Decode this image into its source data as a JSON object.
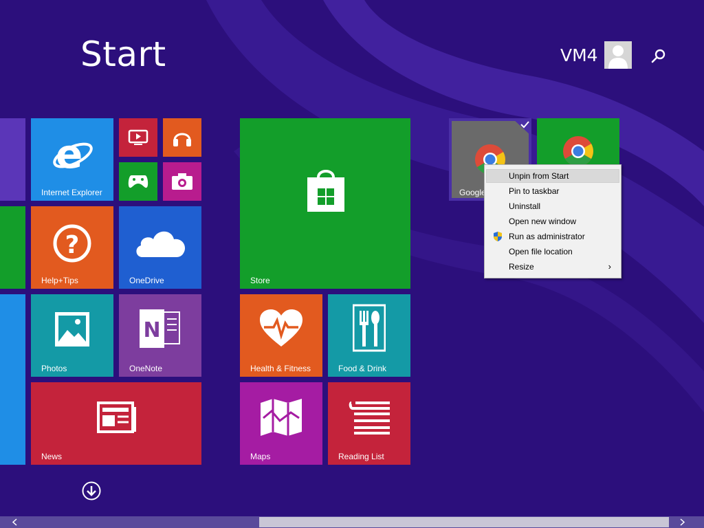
{
  "header": {
    "title": "Start",
    "user_name": "VM4"
  },
  "tiles": [
    {
      "id": "internet-explorer",
      "label": "Internet Explorer",
      "color": "#1f8ee6",
      "icon": "internet-explorer-icon"
    },
    {
      "id": "video",
      "label": "",
      "color": "#c4233b",
      "icon": "video-icon"
    },
    {
      "id": "music",
      "label": "",
      "color": "#e25a1f",
      "icon": "headphones-icon"
    },
    {
      "id": "games",
      "label": "",
      "color": "#139e2a",
      "icon": "xbox-controller-icon"
    },
    {
      "id": "camera",
      "label": "",
      "color": "#b81c8e",
      "icon": "camera-icon"
    },
    {
      "id": "help-tips",
      "label": "Help+Tips",
      "color": "#e25a1f",
      "icon": "question-icon"
    },
    {
      "id": "onedrive",
      "label": "OneDrive",
      "color": "#1f5fd1",
      "icon": "cloud-icon"
    },
    {
      "id": "photos",
      "label": "Photos",
      "color": "#149aa6",
      "icon": "photo-icon"
    },
    {
      "id": "onenote",
      "label": "OneNote",
      "color": "#7d3d9e",
      "icon": "onenote-icon"
    },
    {
      "id": "news",
      "label": "News",
      "color": "#c4233b",
      "icon": "news-icon"
    },
    {
      "id": "store",
      "label": "Store",
      "color": "#139e2a",
      "icon": "store-bag-icon"
    },
    {
      "id": "health-fitness",
      "label": "Health & Fitness",
      "color": "#e25a1f",
      "icon": "heart-pulse-icon"
    },
    {
      "id": "food-drink",
      "label": "Food & Drink",
      "color": "#149aa6",
      "icon": "fork-knife-icon"
    },
    {
      "id": "maps",
      "label": "Maps",
      "color": "#a51ca3",
      "icon": "map-icon"
    },
    {
      "id": "reading-list",
      "label": "Reading List",
      "color": "#c4233b",
      "icon": "reading-list-icon"
    },
    {
      "id": "google-chrome-selected",
      "label": "Google",
      "color": "#6a6a6a",
      "icon": "chrome-icon"
    },
    {
      "id": "google-chrome-2",
      "label": "",
      "color": "#139e2a",
      "icon": "chrome-icon"
    }
  ],
  "context_menu": {
    "items": [
      {
        "label": "Unpin from Start",
        "highlighted": true
      },
      {
        "label": "Pin to taskbar"
      },
      {
        "label": "Uninstall"
      },
      {
        "label": "Open new window"
      },
      {
        "label": "Run as administrator",
        "icon": "uac-shield-icon"
      },
      {
        "label": "Open file location"
      },
      {
        "label": "Resize",
        "submenu_arrow": "›"
      }
    ]
  },
  "colors": {
    "background": "#2b0f7a",
    "accent_purple": "#4a2fa6"
  }
}
